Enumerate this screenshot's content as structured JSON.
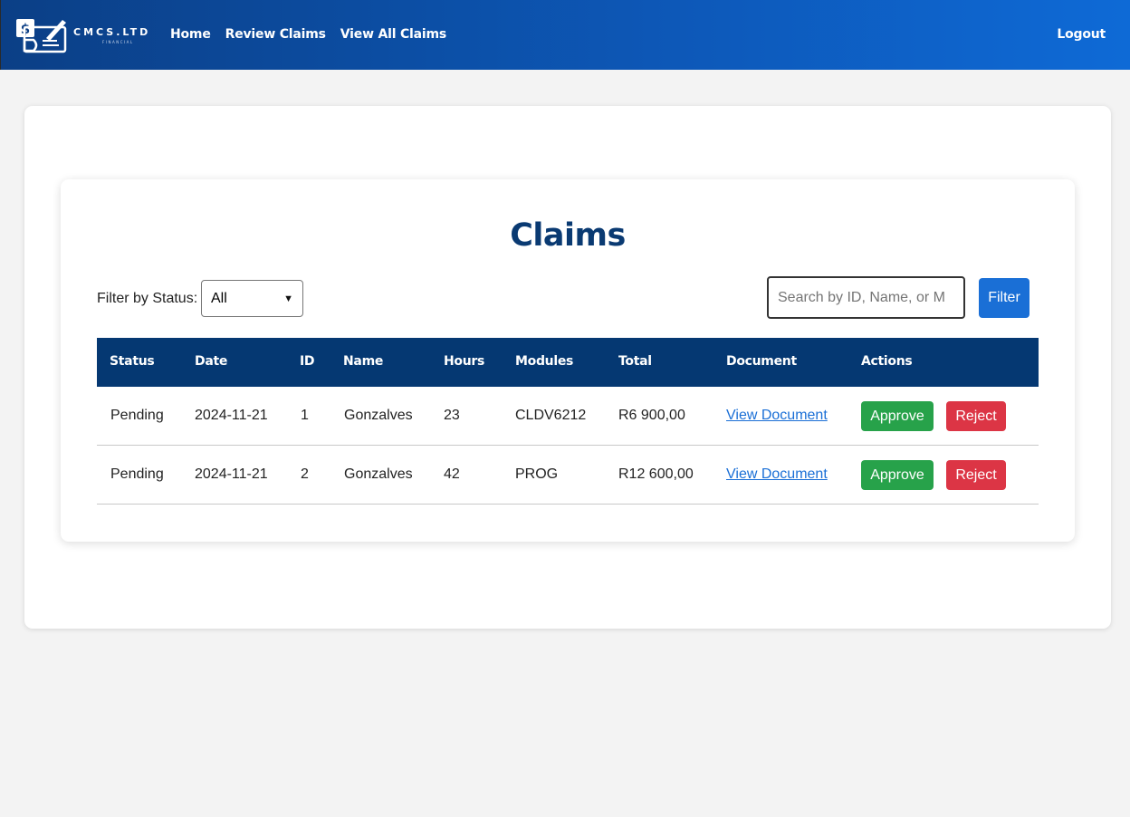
{
  "brand": {
    "name": "CMCS.LTD",
    "tagline": "FINANCIAL"
  },
  "nav": {
    "links": [
      "Home",
      "Review Claims",
      "View All Claims"
    ],
    "logout": "Logout"
  },
  "page": {
    "title": "Claims",
    "filter_label": "Filter by Status:",
    "status_selected": "All",
    "search_placeholder": "Search by ID, Name, or M",
    "filter_button": "Filter"
  },
  "table": {
    "headers": [
      "Status",
      "Date",
      "ID",
      "Name",
      "Hours",
      "Modules",
      "Total",
      "Document",
      "Actions"
    ],
    "rows": [
      {
        "status": "Pending",
        "date": "2024-11-21",
        "id": "1",
        "name": "Gonzalves",
        "hours": "23",
        "modules": "CLDV6212",
        "total": "R6 900,00",
        "document": "View Document",
        "approve": "Approve",
        "reject": "Reject"
      },
      {
        "status": "Pending",
        "date": "2024-11-21",
        "id": "2",
        "name": "Gonzalves",
        "hours": "42",
        "modules": "PROG",
        "total": "R12 600,00",
        "document": "View Document",
        "approve": "Approve",
        "reject": "Reject"
      }
    ]
  },
  "colors": {
    "navbar": "#0b3f86",
    "table_header": "#053872",
    "title": "#0a3a72",
    "primary": "#1a6fd6",
    "approve": "#27a24a",
    "reject": "#dc3545"
  }
}
